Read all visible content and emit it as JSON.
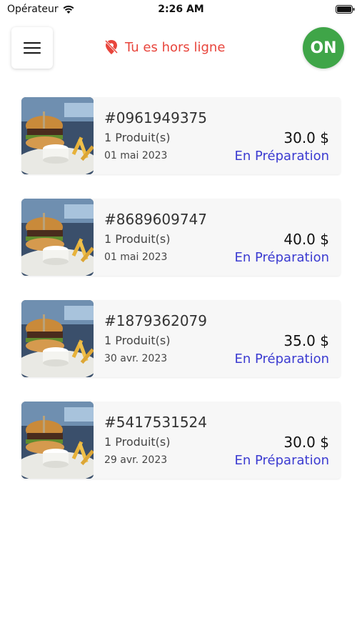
{
  "status_bar": {
    "carrier": "Opérateur",
    "time": "2:26 AM"
  },
  "header": {
    "offline_text": "Tu es hors ligne",
    "toggle_label": "ON"
  },
  "colors": {
    "offline": "#e8453c",
    "toggle_on": "#3fa548",
    "status": "#3b3bd1"
  },
  "orders": [
    {
      "id": "#0961949375",
      "quantity": "1 Produit(s)",
      "date": "01 mai 2023",
      "price": "30.0 $",
      "status": "En Préparation"
    },
    {
      "id": "#8689609747",
      "quantity": "1 Produit(s)",
      "date": "01 mai 2023",
      "price": "40.0 $",
      "status": "En Préparation"
    },
    {
      "id": "#1879362079",
      "quantity": "1 Produit(s)",
      "date": "30 avr. 2023",
      "price": "35.0 $",
      "status": "En Préparation"
    },
    {
      "id": "#5417531524",
      "quantity": "1 Produit(s)",
      "date": "29 avr. 2023",
      "price": "30.0 $",
      "status": "En Préparation"
    }
  ]
}
